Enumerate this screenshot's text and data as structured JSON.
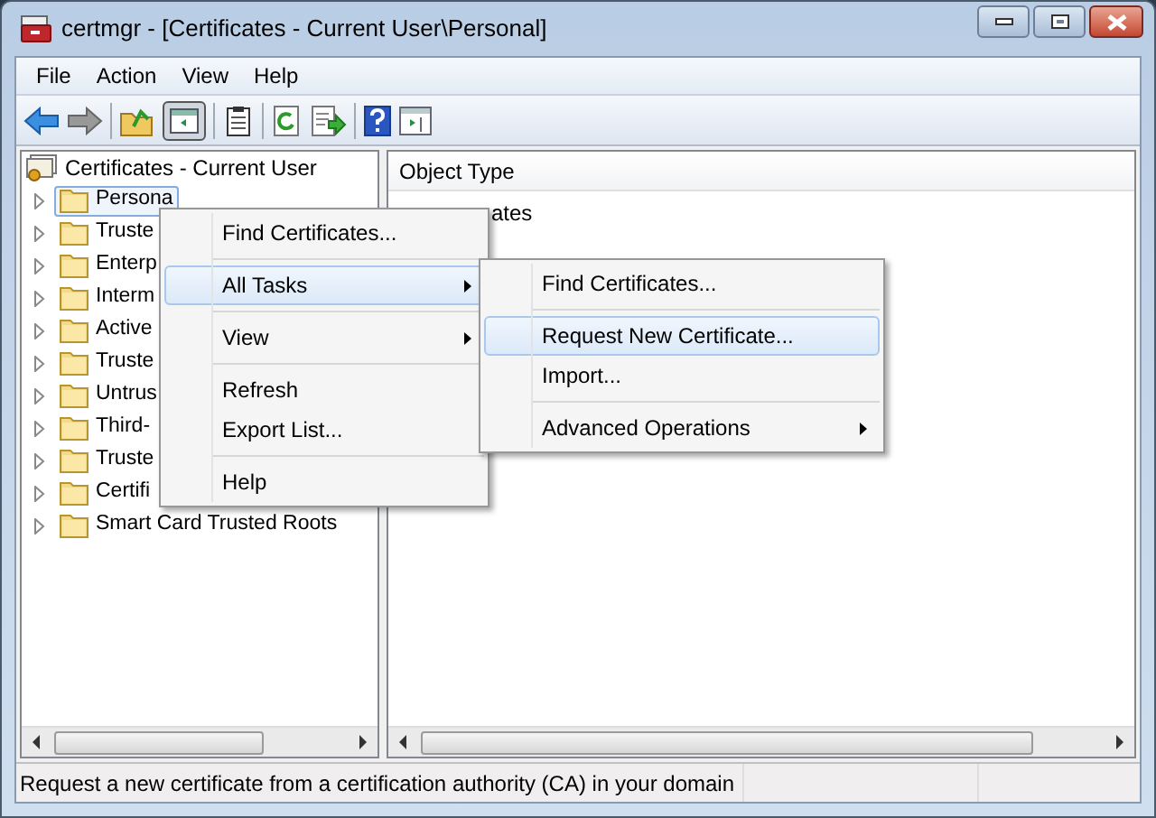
{
  "window": {
    "title": "certmgr - [Certificates - Current User\\Personal]"
  },
  "menu_bar": [
    "File",
    "Action",
    "View",
    "Help"
  ],
  "tree": {
    "root": "Certificates - Current User",
    "children": [
      {
        "label": "Persona",
        "selected": true
      },
      {
        "label": "Truste",
        "selected": false
      },
      {
        "label": "Enterp",
        "selected": false
      },
      {
        "label": "Interm",
        "selected": false
      },
      {
        "label": "Active",
        "selected": false
      },
      {
        "label": "Truste",
        "selected": false
      },
      {
        "label": "Untrus",
        "selected": false
      },
      {
        "label": "Third-",
        "selected": false
      },
      {
        "label": "Truste",
        "selected": false
      },
      {
        "label": "Certifi",
        "selected": false
      },
      {
        "label": "Smart Card Trusted Roots",
        "selected": false
      }
    ]
  },
  "list": {
    "columns": [
      "Object Type"
    ],
    "rows": [
      "ates"
    ]
  },
  "context_menu": {
    "items": [
      {
        "kind": "item",
        "label": "Find Certificates...",
        "submenu": false,
        "selected": false
      },
      {
        "kind": "separator"
      },
      {
        "kind": "item",
        "label": "All Tasks",
        "submenu": true,
        "selected": true
      },
      {
        "kind": "separator"
      },
      {
        "kind": "item",
        "label": "View",
        "submenu": true,
        "selected": false
      },
      {
        "kind": "separator"
      },
      {
        "kind": "item",
        "label": "Refresh",
        "submenu": false,
        "selected": false
      },
      {
        "kind": "item",
        "label": "Export List...",
        "submenu": false,
        "selected": false
      },
      {
        "kind": "separator"
      },
      {
        "kind": "item",
        "label": "Help",
        "submenu": false,
        "selected": false
      }
    ]
  },
  "submenu": {
    "items": [
      {
        "kind": "item",
        "label": "Find Certificates...",
        "submenu": false,
        "selected": false
      },
      {
        "kind": "separator"
      },
      {
        "kind": "item",
        "label": "Request New Certificate...",
        "submenu": false,
        "selected": true
      },
      {
        "kind": "item",
        "label": "Import...",
        "submenu": false,
        "selected": false
      },
      {
        "kind": "separator"
      },
      {
        "kind": "item",
        "label": "Advanced Operations",
        "submenu": true,
        "selected": false
      }
    ]
  },
  "status_bar": {
    "text": "Request a new certificate from a certification authority (CA) in your domain"
  }
}
